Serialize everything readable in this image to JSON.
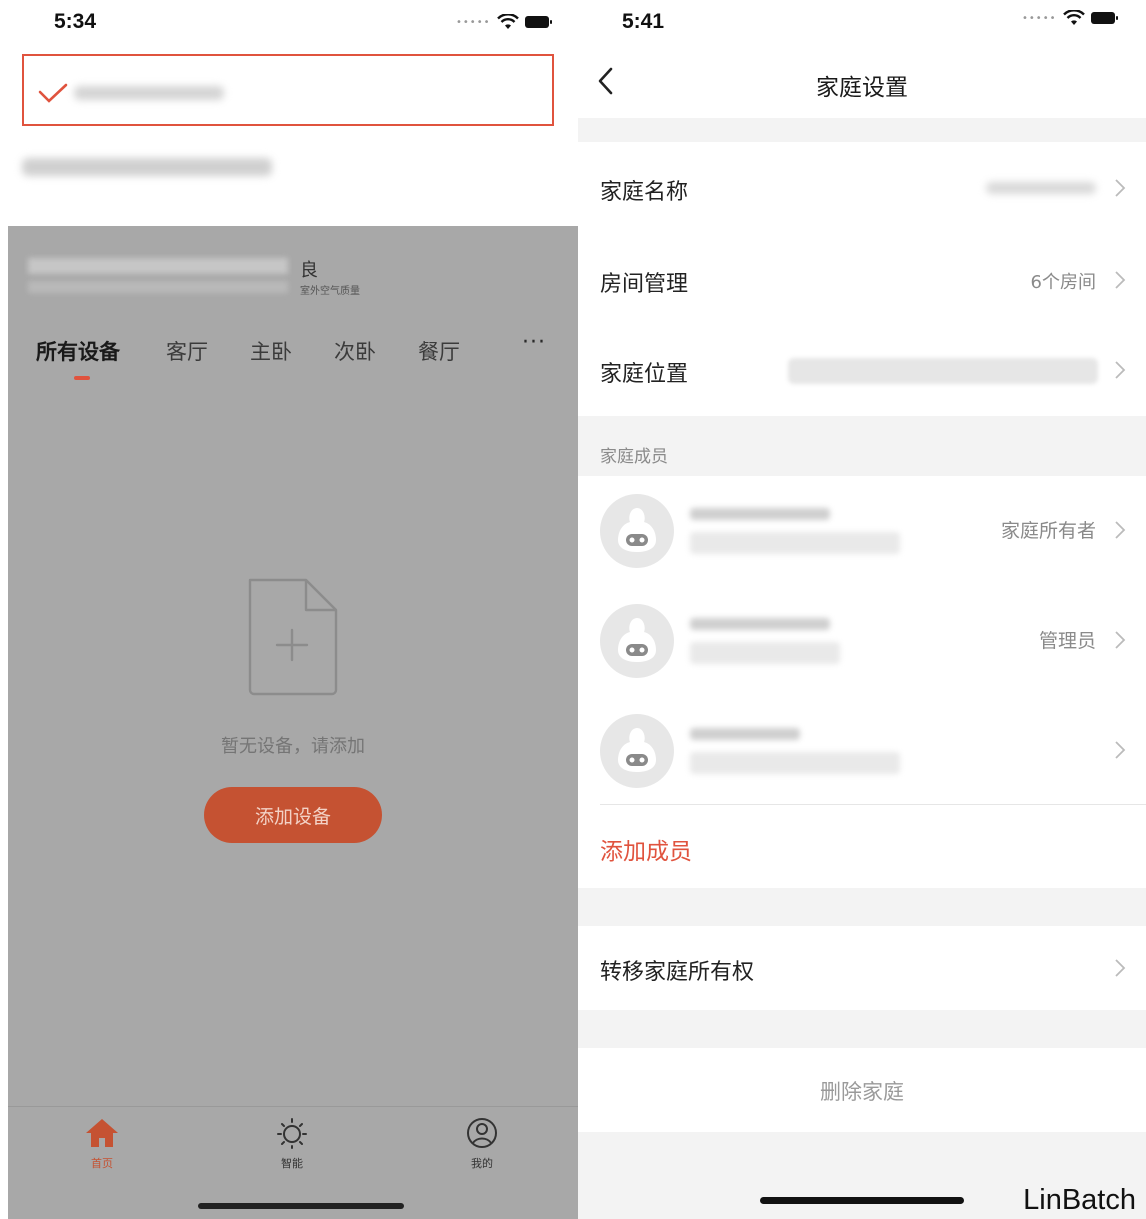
{
  "left_screen": {
    "status_bar": {
      "time": "5:34"
    },
    "air_quality": {
      "value": "良",
      "label": "室外空气质量"
    },
    "room_tabs": [
      "所有设备",
      "客厅",
      "主卧",
      "次卧",
      "餐厅"
    ],
    "more_label": "···",
    "empty_state": {
      "message": "暂无设备，请添加",
      "button_label": "添加设备"
    },
    "tab_bar": [
      {
        "label": "首页",
        "icon": "home-icon",
        "active": true
      },
      {
        "label": "智能",
        "icon": "sun-icon",
        "active": false
      },
      {
        "label": "我的",
        "icon": "profile-icon",
        "active": false
      }
    ]
  },
  "right_screen": {
    "status_bar": {
      "time": "5:41"
    },
    "nav": {
      "title": "家庭设置"
    },
    "settings": {
      "family_name": {
        "label": "家庭名称"
      },
      "room_management": {
        "label": "房间管理",
        "value": "6个房间"
      },
      "family_location": {
        "label": "家庭位置"
      }
    },
    "members_section": {
      "header": "家庭成员",
      "members": [
        {
          "role": "家庭所有者"
        },
        {
          "role": "管理员"
        },
        {
          "role": ""
        }
      ],
      "add_member_label": "添加成员"
    },
    "transfer_ownership": {
      "label": "转移家庭所有权"
    },
    "delete_family": {
      "label": "删除家庭"
    }
  },
  "watermark": "LinBatch",
  "colors": {
    "accent": "#e0533e",
    "button_dimmed": "#c55232",
    "overlay": "#a8a8a8"
  }
}
